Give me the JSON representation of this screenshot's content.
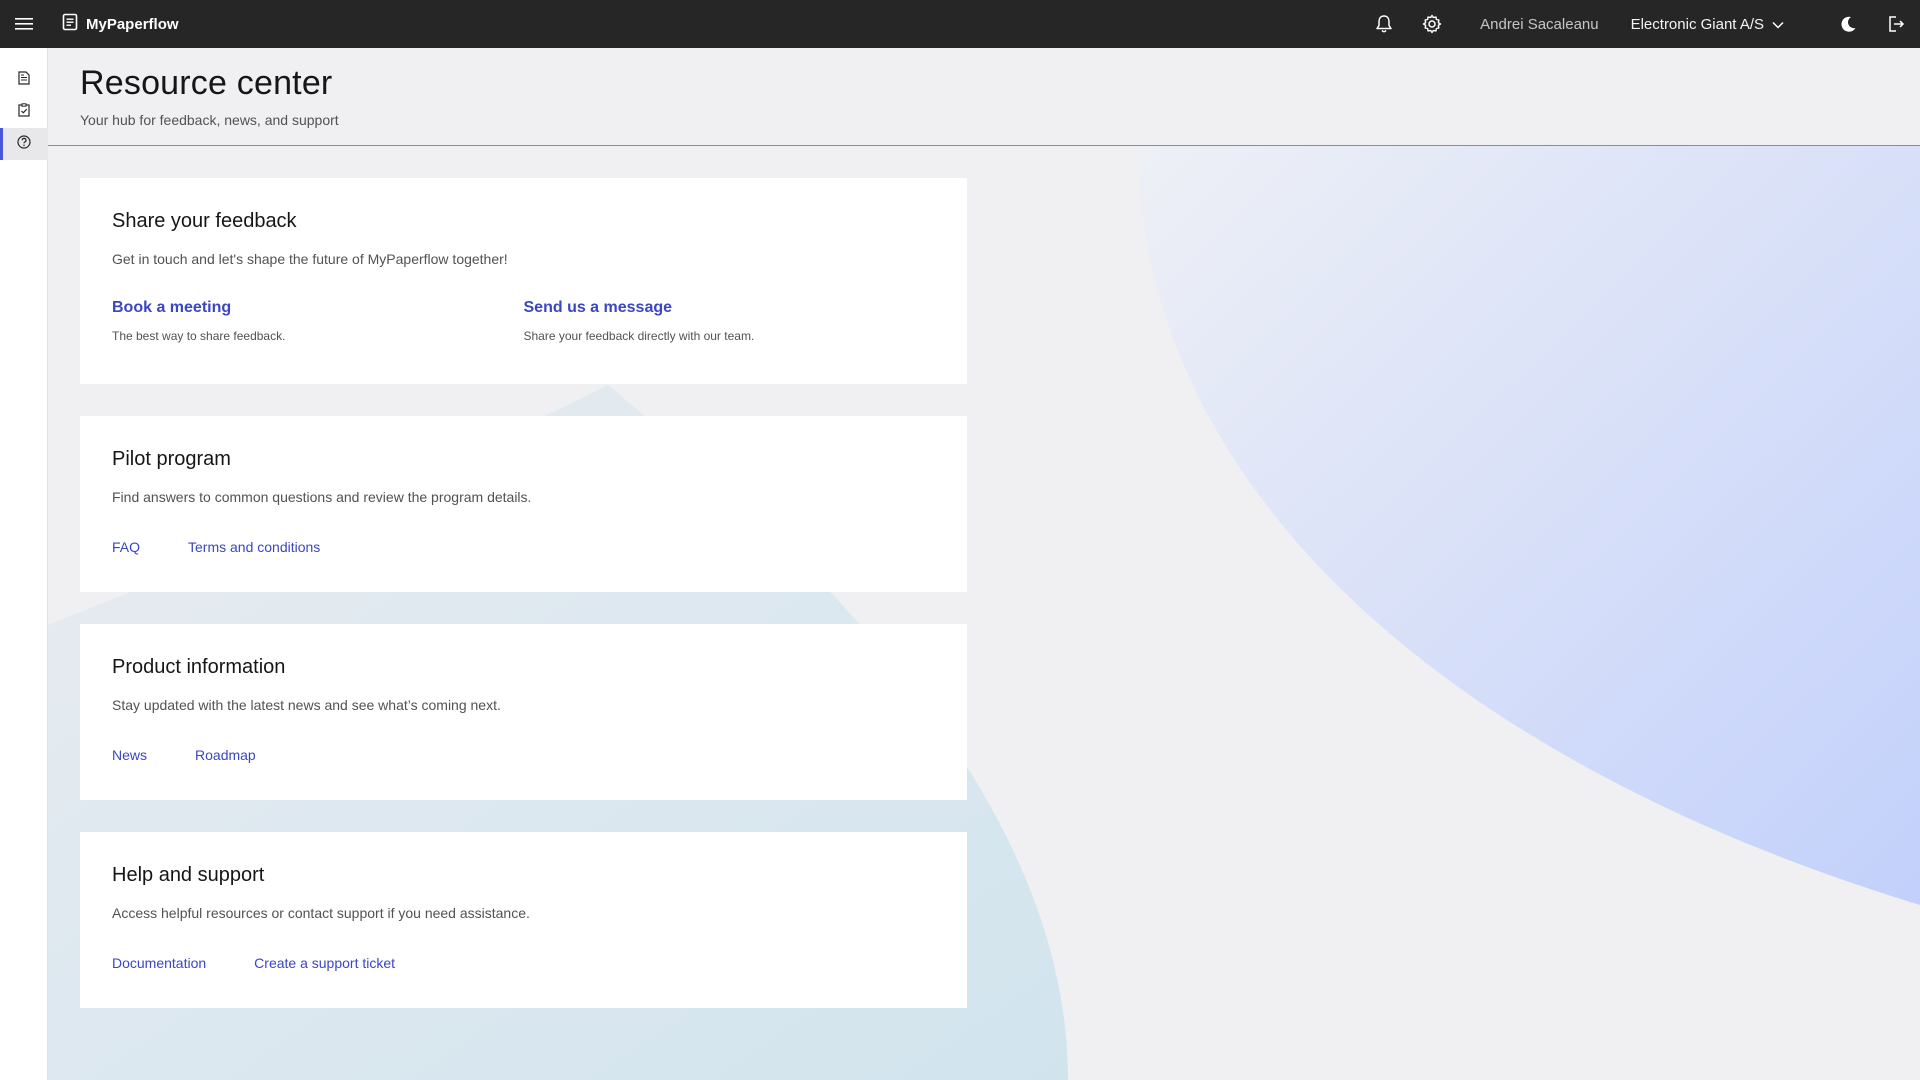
{
  "topbar": {
    "brand": "MyPaperflow",
    "user": "Andrei Sacaleanu",
    "organization": "Electronic Giant A/S"
  },
  "header": {
    "title": "Resource center",
    "subtitle": "Your hub for feedback, news, and support"
  },
  "cards": {
    "feedback": {
      "title": "Share your feedback",
      "description": "Get in touch and let's shape the future of MyPaperflow together!",
      "meeting_label": "Book a meeting",
      "meeting_desc": "The best way to share feedback.",
      "message_label": "Send us a message",
      "message_desc": "Share your feedback directly with our team."
    },
    "pilot": {
      "title": "Pilot program",
      "description": "Find answers to common questions and review the program details.",
      "link1": "FAQ",
      "link2": "Terms and conditions"
    },
    "product": {
      "title": "Product information",
      "description": "Stay updated with the latest news and see what’s coming next.",
      "link1": "News",
      "link2": "Roadmap"
    },
    "help": {
      "title": "Help and support",
      "description": "Access helpful resources or contact support if you need assistance.",
      "link1": "Documentation",
      "link2": "Create a support ticket"
    }
  },
  "colors": {
    "topbar": "#262626",
    "accent": "#4a56d8",
    "link": "#3a46c4"
  }
}
